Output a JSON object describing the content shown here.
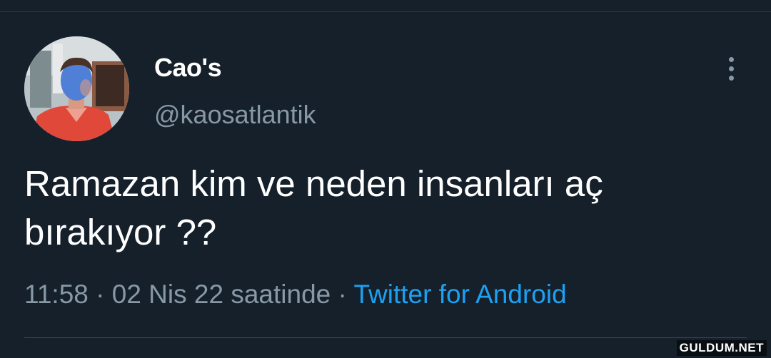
{
  "tweet": {
    "display_name": "Cao's",
    "handle": "@kaosatlantik",
    "text_line1": "Ramazan kim ve neden insanları aç",
    "text_line2": "bırakıyor ??",
    "time": "11:58",
    "date": "02 Nis 22 saatinde",
    "separator": "·",
    "source": "Twitter for Android"
  },
  "icons": {
    "more": "more-vertical-icon",
    "avatar": "profile-photo"
  },
  "colors": {
    "background": "#15202b",
    "link": "#1da1f2",
    "secondary_text": "#8899a6"
  },
  "watermark": "GULDUM.NET"
}
